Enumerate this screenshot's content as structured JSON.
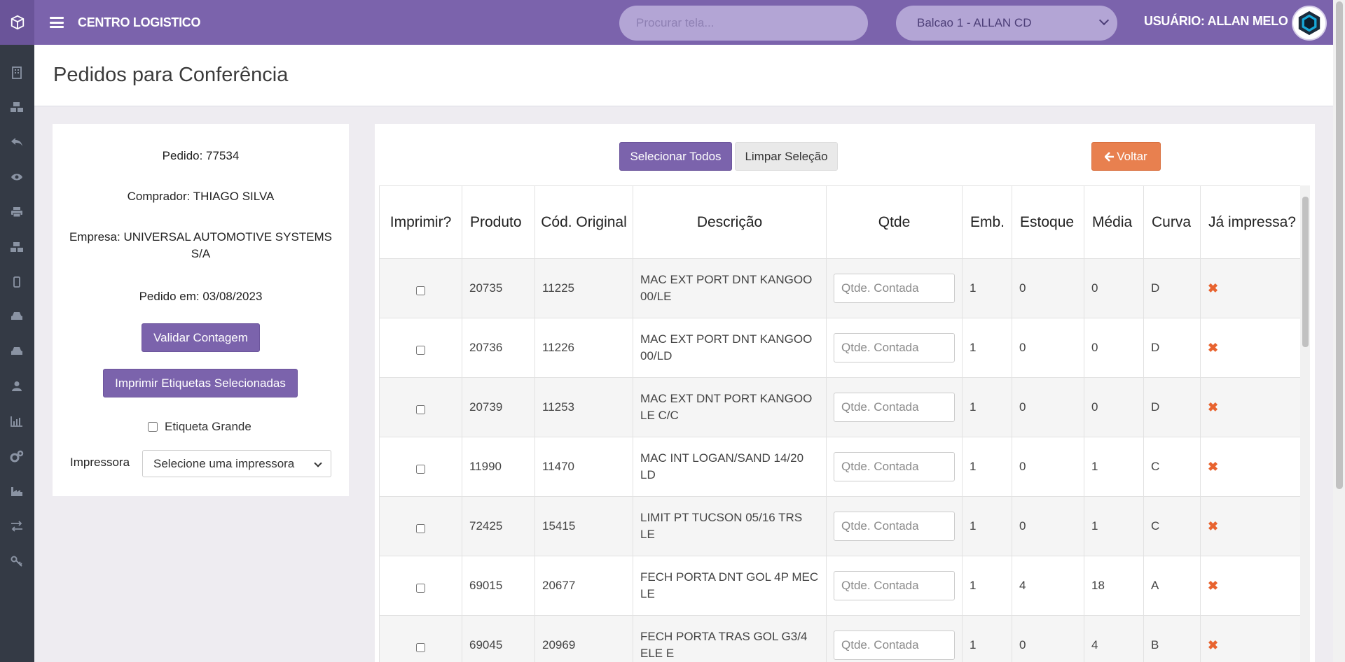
{
  "topbar": {
    "brand": "CENTRO LOGISTICO",
    "search_placeholder": "Procurar tela...",
    "branch": "Balcao 1 - ALLAN CD",
    "user": "USUÁRIO: ALLAN MELO"
  },
  "sidebar": {
    "icons": [
      "building-icon",
      "boxes-icon",
      "reply-icon",
      "eye-icon",
      "print-icon",
      "cubes-icon",
      "mobile-icon",
      "car-icon",
      "car-icon",
      "user-icon",
      "bar-chart-icon",
      "gears-icon",
      "industry-icon",
      "exchange-icon",
      "key-icon"
    ]
  },
  "page": {
    "title": "Pedidos para Conferência"
  },
  "order": {
    "pedido": "Pedido: 77534",
    "comprador": "Comprador: THIAGO SILVA",
    "empresa": "Empresa: UNIVERSAL AUTOMOTIVE SYSTEMS S/A",
    "data": "Pedido em: 03/08/2023",
    "validate_label": "Validar Contagem",
    "print_label": "Imprimir Etiquetas Selecionadas",
    "big_label": "Etiqueta Grande",
    "printer_label": "Impressora",
    "printer_value": "Selecione uma impressora"
  },
  "toolbar": {
    "select_all": "Selecionar Todos",
    "clear": "Limpar Seleção",
    "back": "Voltar"
  },
  "table": {
    "headers": [
      "Imprimir?",
      "Produto",
      "Cód. Original",
      "Descrição",
      "Qtde",
      "Emb.",
      "Estoque",
      "Média",
      "Curva",
      "Já impressa?"
    ],
    "qty_placeholder": "Qtde. Contada",
    "not_printed_mark": "✖",
    "rows": [
      {
        "produto": "20735",
        "cod": "11225",
        "desc": "MAC EXT PORT DNT KANGOO 00/LE",
        "emb": "1",
        "estoque": "0",
        "media": "0",
        "curva": "D"
      },
      {
        "produto": "20736",
        "cod": "11226",
        "desc": "MAC EXT PORT DNT KANGOO 00/LD",
        "emb": "1",
        "estoque": "0",
        "media": "0",
        "curva": "D"
      },
      {
        "produto": "20739",
        "cod": "11253",
        "desc": "MAC EXT DNT PORT KANGOO LE C/C",
        "emb": "1",
        "estoque": "0",
        "media": "0",
        "curva": "D"
      },
      {
        "produto": "11990",
        "cod": "11470",
        "desc": "MAC INT LOGAN/SAND 14/20 LD",
        "emb": "1",
        "estoque": "0",
        "media": "1",
        "curva": "C"
      },
      {
        "produto": "72425",
        "cod": "15415",
        "desc": "LIMIT PT TUCSON 05/16 TRS LE",
        "emb": "1",
        "estoque": "0",
        "media": "1",
        "curva": "C"
      },
      {
        "produto": "69015",
        "cod": "20677",
        "desc": "FECH PORTA DNT GOL 4P MEC LE",
        "emb": "1",
        "estoque": "4",
        "media": "18",
        "curva": "A"
      },
      {
        "produto": "69045",
        "cod": "20969",
        "desc": "FECH PORTA TRAS GOL G3/4 ELE E",
        "emb": "1",
        "estoque": "0",
        "media": "4",
        "curva": "B"
      }
    ]
  },
  "colors": {
    "brand": "#7b63ac",
    "sidebar": "#343a45",
    "accent_orange": "#e8804f",
    "x_mark": "#e8632f"
  }
}
